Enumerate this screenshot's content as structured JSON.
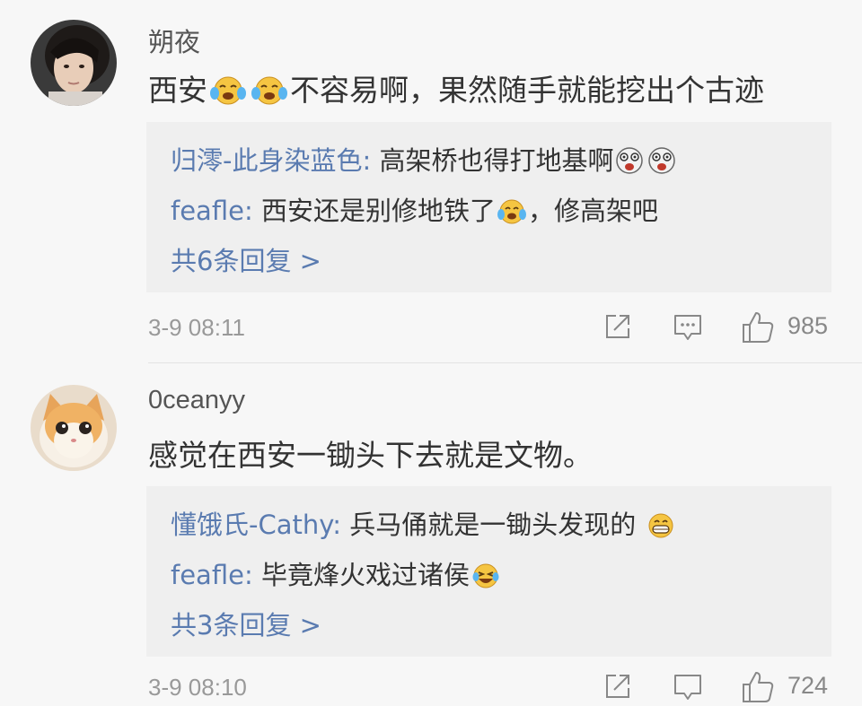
{
  "comments": [
    {
      "username": "朔夜",
      "avatar": "avatar-girl",
      "content_before": "西安",
      "content_emojis": [
        "laugh-cry-icon",
        "laugh-cry-icon"
      ],
      "content_after": "不容易啊，果然随手就能挖出个古迹",
      "replies": [
        {
          "name": "归澪-此身染蓝色",
          "separator": ": ",
          "text": "高架桥也得打地基啊",
          "emojis": [
            "shocked-icon",
            "shocked-icon"
          ]
        },
        {
          "name": "feafle",
          "separator": ": ",
          "text_before": "西安还是别修地铁了",
          "emojis": [
            "laugh-cry-icon"
          ],
          "text_after": "，修高架吧"
        }
      ],
      "more_replies": "共6条回复 >",
      "timestamp": "3-9 08:11",
      "likes": "985"
    },
    {
      "username": "0ceanyy",
      "avatar": "avatar-cat",
      "content": "感觉在西安一锄头下去就是文物。",
      "replies": [
        {
          "name": "懂饿氏-Cathy",
          "separator": ": ",
          "text": "兵马俑就是一锄头发现的",
          "emojis": [
            "grin-icon"
          ]
        },
        {
          "name": "feafle",
          "separator": ": ",
          "text": "毕竟烽火戏过诸侯",
          "emojis": [
            "laugh-tears-icon"
          ]
        }
      ],
      "more_replies": "共3条回复 >",
      "timestamp": "3-9 08:10",
      "likes": "724"
    }
  ],
  "colors": {
    "background": "#f7f7f7",
    "reply_box": "#efefef",
    "link_blue": "#5a7bb0",
    "meta_gray": "#999999"
  }
}
